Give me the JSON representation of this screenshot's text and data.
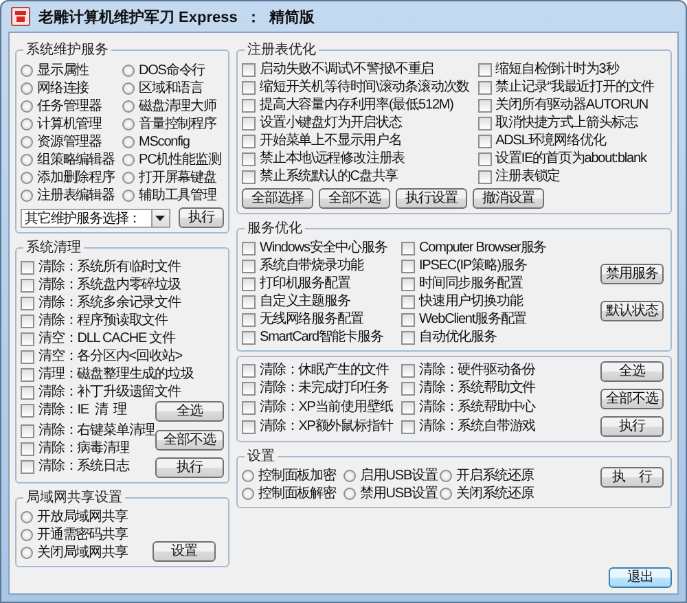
{
  "window": {
    "title": "老雕计算机维护军刀 Express  ：  精简版"
  },
  "maintenance": {
    "title": "系统维护服务",
    "items": [
      {
        "label": "显示属性",
        "selected": false
      },
      {
        "label": "DOS命令行",
        "selected": false
      },
      {
        "label": "网络连接",
        "selected": false
      },
      {
        "label": "区域和语言",
        "selected": false
      },
      {
        "label": "任务管理器",
        "selected": false
      },
      {
        "label": "磁盘清理大师",
        "selected": false
      },
      {
        "label": "计算机管理",
        "selected": false
      },
      {
        "label": "音量控制程序",
        "selected": false
      },
      {
        "label": "资源管理器",
        "selected": false
      },
      {
        "label": "MSconfig",
        "selected": false
      },
      {
        "label": "组策略编辑器",
        "selected": false
      },
      {
        "label": "PC机性能监测",
        "selected": false
      },
      {
        "label": "添加删除程序",
        "selected": false
      },
      {
        "label": "打开屏幕键盘",
        "selected": false
      },
      {
        "label": "注册表编辑器",
        "selected": false
      },
      {
        "label": "辅助工具管理",
        "selected": false
      }
    ],
    "dropdown": {
      "value": "其它维护服务选择："
    },
    "button": "执行"
  },
  "cleanup": {
    "title": "系统清理",
    "items": [
      {
        "label": "清除：系统所有临时文件",
        "checked": false
      },
      {
        "label": "清除：系统盘内零碎垃圾",
        "checked": false
      },
      {
        "label": "清除：系统多余记录文件",
        "checked": false
      },
      {
        "label": "清除：程序预读取文件",
        "checked": false
      },
      {
        "label": "清空：DLL CACHE 文件",
        "checked": false
      },
      {
        "label": "清空：各分区内<回收站>",
        "checked": false
      },
      {
        "label": "清理：磁盘整理生成的垃圾",
        "checked": false
      },
      {
        "label": "清除：补丁升级遗留文件",
        "checked": false
      },
      {
        "label": "清除：IE  清  理",
        "checked": false
      },
      {
        "label": "清除：右键菜单清理",
        "checked": false
      },
      {
        "label": "清除：病毒清理",
        "checked": false
      },
      {
        "label": "清除：系统日志",
        "checked": false
      }
    ],
    "buttons": [
      "全选",
      "全部不选",
      "执行"
    ]
  },
  "lan": {
    "title": "局域网共享设置",
    "items": [
      {
        "label": "开放局域网共享",
        "selected": false
      },
      {
        "label": "开通需密码共享",
        "selected": false
      },
      {
        "label": "关闭局域网共享",
        "selected": false
      }
    ],
    "button": "设置"
  },
  "registry": {
    "title": "注册表优化",
    "items": [
      {
        "label": "启动失败不调试\\不警报\\不重启",
        "checked": false
      },
      {
        "label": "缩短自检倒计时为3秒",
        "checked": false
      },
      {
        "label": "缩短开关机等待时间\\滚动条滚动次数",
        "checked": false
      },
      {
        "label": "禁止记录“我最近打开的文件",
        "checked": false
      },
      {
        "label": "提高大容量内存利用率(最低512M)",
        "checked": false
      },
      {
        "label": "关闭所有驱动器AUTORUN",
        "checked": false
      },
      {
        "label": "设置小键盘灯为开启状态",
        "checked": false
      },
      {
        "label": "取消快捷方式上箭头标志",
        "checked": false
      },
      {
        "label": "开始菜单上不显示用户名",
        "checked": false
      },
      {
        "label": "ADSL环境网络优化",
        "checked": false
      },
      {
        "label": "禁止本地\\远程修改注册表",
        "checked": false
      },
      {
        "label": "设置IE的首页为about:blank",
        "checked": false
      },
      {
        "label": "禁止系统默认的C盘共享",
        "checked": false
      },
      {
        "label": "注册表锁定",
        "checked": false
      }
    ],
    "buttons": [
      "全部选择",
      "全部不选",
      "执行设置",
      "撤消设置"
    ]
  },
  "services": {
    "title": "服务优化",
    "items": [
      {
        "label": "Windows安全中心服务",
        "checked": false
      },
      {
        "label": "Computer Browser服务",
        "checked": false
      },
      {
        "label": "系统自带烧录功能",
        "checked": false
      },
      {
        "label": "IPSEC(IP策略)服务",
        "checked": false
      },
      {
        "label": "打印机服务配置",
        "checked": false
      },
      {
        "label": "时间同步服务配置",
        "checked": false
      },
      {
        "label": "自定义主题服务",
        "checked": false
      },
      {
        "label": "快速用户切换功能",
        "checked": false
      },
      {
        "label": "无线网络服务配置",
        "checked": false
      },
      {
        "label": "WebClient服务配置",
        "checked": false
      },
      {
        "label": "SmartCard智能卡服务",
        "checked": false
      },
      {
        "label": "自动优化服务",
        "checked": false
      }
    ],
    "buttons": [
      "禁用服务",
      "默认状态"
    ]
  },
  "extra_cleanup": {
    "items": [
      {
        "label": "清除：休眠产生的文件",
        "checked": false
      },
      {
        "label": "清除：硬件驱动备份",
        "checked": false
      },
      {
        "label": "清除：未完成打印任务",
        "checked": false
      },
      {
        "label": "清除：系统帮助文件",
        "checked": false
      },
      {
        "label": "清除：XP当前使用壁纸",
        "checked": false
      },
      {
        "label": "清除：系统帮助中心",
        "checked": false
      },
      {
        "label": "清除：XP额外鼠标指针",
        "checked": false
      },
      {
        "label": "清除：系统自带游戏",
        "checked": false
      }
    ],
    "buttons": [
      "全选",
      "全部不选",
      "执行"
    ]
  },
  "settings": {
    "title": "设置",
    "items": [
      {
        "label": "控制面板加密",
        "selected": false
      },
      {
        "label": "启用USB设置",
        "selected": false
      },
      {
        "label": "开启系统还原",
        "selected": false
      },
      {
        "label": "控制面板解密",
        "selected": false
      },
      {
        "label": "禁用USB设置",
        "selected": false
      },
      {
        "label": "关闭系统还原",
        "selected": false
      }
    ],
    "button": "执    行"
  },
  "exit_button": "退出"
}
